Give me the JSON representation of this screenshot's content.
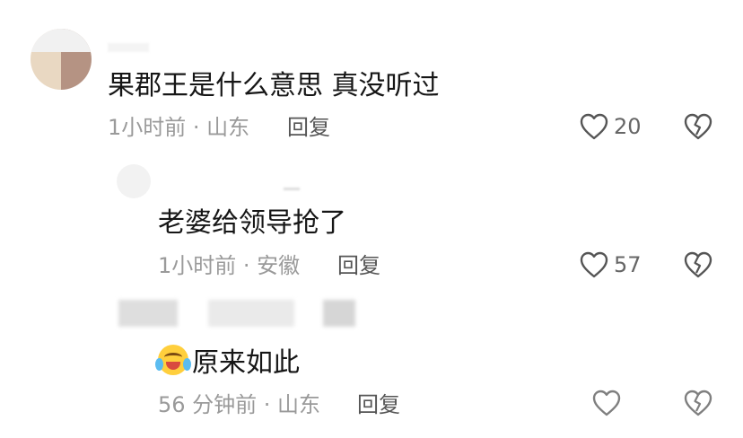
{
  "comments": [
    {
      "text": "果郡王是什么意思 真没听过",
      "meta": "1小时前 · 山东",
      "reply_label": "回复",
      "likes": "20"
    },
    {
      "text": "老婆给领导抢了",
      "meta": "1小时前 · 安徽",
      "reply_label": "回复",
      "likes": "57"
    },
    {
      "text": "原来如此",
      "meta": "56 分钟前 · 山东",
      "reply_label": "回复"
    }
  ]
}
